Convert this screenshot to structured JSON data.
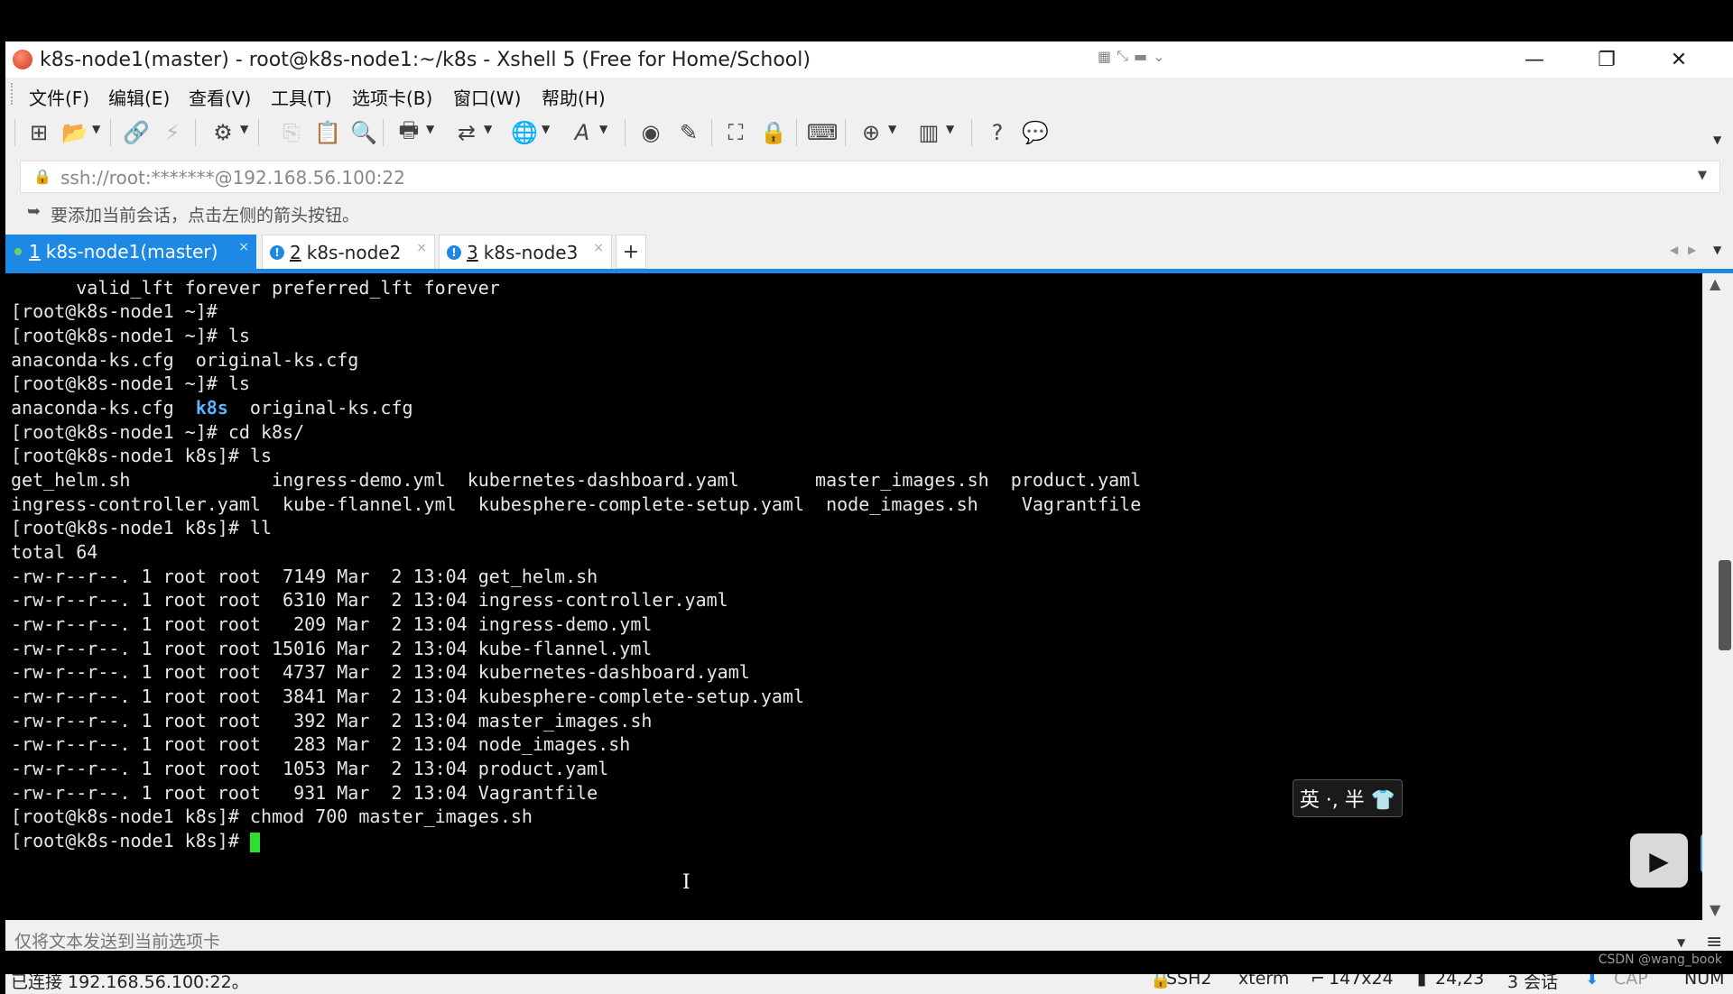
{
  "window": {
    "title": "k8s-node1(master) - root@k8s-node1:~/k8s - Xshell 5 (Free for Home/School)",
    "minimize": "—",
    "restore": "❐",
    "close": "✕"
  },
  "menu": [
    {
      "label": "文件(F)"
    },
    {
      "label": "编辑(E)"
    },
    {
      "label": "查看(V)"
    },
    {
      "label": "工具(T)"
    },
    {
      "label": "选项卡(B)"
    },
    {
      "label": "窗口(W)"
    },
    {
      "label": "帮助(H)"
    }
  ],
  "address": {
    "value": "ssh://root:*******@192.168.56.100:22"
  },
  "hint": {
    "text": "要添加当前会话，点击左侧的箭头按钮。"
  },
  "tabs": [
    {
      "num": "1",
      "label": "k8s-node1(master)",
      "active": true
    },
    {
      "num": "2",
      "label": "k8s-node2",
      "active": false
    },
    {
      "num": "3",
      "label": "k8s-node3",
      "active": false
    }
  ],
  "terminal": {
    "lines": [
      "      valid_lft forever preferred_lft forever",
      "[root@k8s-node1 ~]#",
      "[root@k8s-node1 ~]# ls",
      "anaconda-ks.cfg  original-ks.cfg",
      "[root@k8s-node1 ~]# ls",
      "anaconda-ks.cfg  ",
      "[root@k8s-node1 ~]# cd k8s/",
      "[root@k8s-node1 k8s]# ls",
      "get_helm.sh             ingress-demo.yml  kubernetes-dashboard.yaml       master_images.sh  product.yaml",
      "ingress-controller.yaml  kube-flannel.yml  kubesphere-complete-setup.yaml  node_images.sh    Vagrantfile",
      "[root@k8s-node1 k8s]# ll",
      "total 64",
      "-rw-r--r--. 1 root root  7149 Mar  2 13:04 get_helm.sh",
      "-rw-r--r--. 1 root root  6310 Mar  2 13:04 ingress-controller.yaml",
      "-rw-r--r--. 1 root root   209 Mar  2 13:04 ingress-demo.yml",
      "-rw-r--r--. 1 root root 15016 Mar  2 13:04 kube-flannel.yml",
      "-rw-r--r--. 1 root root  4737 Mar  2 13:04 kubernetes-dashboard.yaml",
      "-rw-r--r--. 1 root root  3841 Mar  2 13:04 kubesphere-complete-setup.yaml",
      "-rw-r--r--. 1 root root   392 Mar  2 13:04 master_images.sh",
      "-rw-r--r--. 1 root root   283 Mar  2 13:04 node_images.sh",
      "-rw-r--r--. 1 root root  1053 Mar  2 13:04 product.yaml",
      "-rw-r--r--. 1 root root   931 Mar  2 13:04 Vagrantfile",
      "[root@k8s-node1 k8s]# chmod 700 master_images.sh",
      "[root@k8s-node1 k8s]# "
    ],
    "dir_name": "k8s",
    "after_dir": "  original-ks.cfg"
  },
  "ime": {
    "label": "英 ·, 半 👕"
  },
  "compose": {
    "placeholder": "仅将文本发送到当前选项卡"
  },
  "status": {
    "connection": "已连接 192.168.56.100:22。",
    "protocol": "SSH2",
    "term": "xterm",
    "size": "147x24",
    "position": "24,23",
    "sessions": "3 会话",
    "cap": "CAP",
    "num": "NUM"
  },
  "watermark": "CSDN @wang_book",
  "colors": {
    "accent": "#1e88e5",
    "terminal_bg": "#000000",
    "terminal_fg": "#e6e6e6",
    "directory": "#5ab4ff",
    "cursor": "#2ee02e"
  },
  "icons": [
    "new-session-icon",
    "open-folder-icon",
    "connect-icon",
    "disconnect-icon",
    "settings-icon",
    "copy-icon",
    "paste-icon",
    "find-icon",
    "print-icon",
    "transfer-icon",
    "globe-icon",
    "font-icon",
    "script-icon",
    "compose-icon",
    "fullscreen-icon",
    "lock-icon",
    "keyboard-icon",
    "add-icon",
    "layout-icon",
    "help-icon",
    "chat-icon"
  ]
}
